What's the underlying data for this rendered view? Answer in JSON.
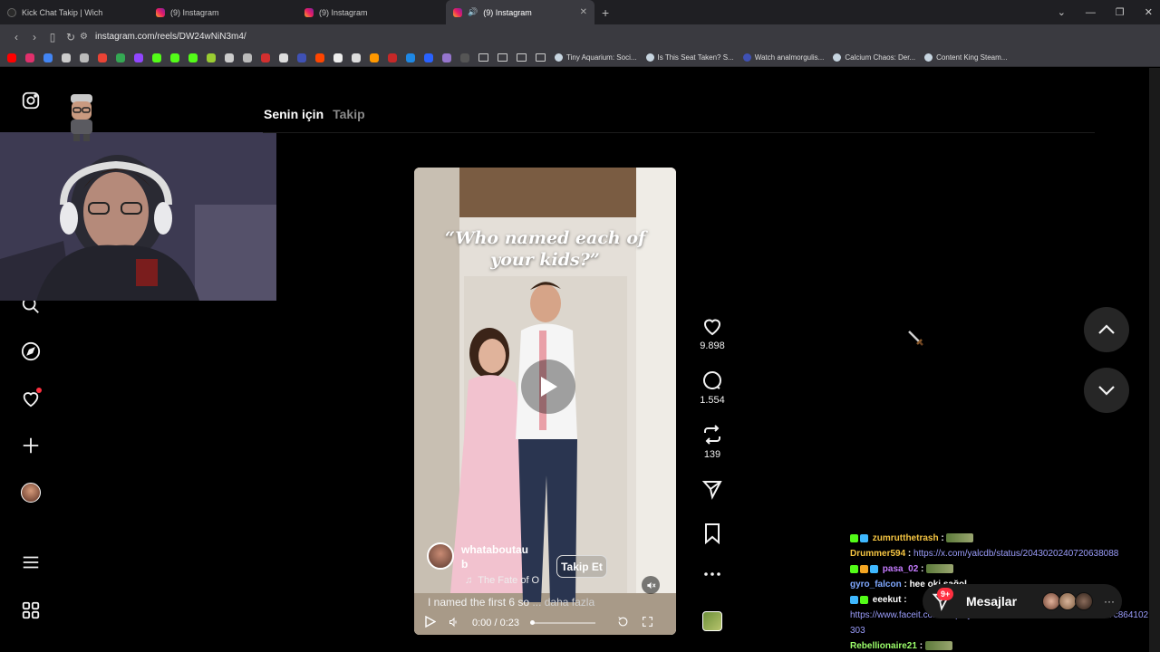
{
  "browser": {
    "tabs": [
      {
        "title": "Kick Chat Takip | Wich",
        "icon": "kick-icon",
        "active": false
      },
      {
        "title": "(9) Instagram",
        "icon": "instagram-icon",
        "active": false
      },
      {
        "title": "(9) Instagram",
        "icon": "instagram-icon",
        "active": false
      },
      {
        "title": "(9) Instagram",
        "icon": "instagram-icon",
        "active": true,
        "audio": true
      }
    ],
    "url": "instagram.com/reels/DW24wNiN3m4/",
    "bookmarks": [
      {
        "label": "Tiny Aquarium: Soci..."
      },
      {
        "label": "Is This Seat Taken? S..."
      },
      {
        "label": "Watch analmorgulis..."
      },
      {
        "label": "Calcium Chaos: Der..."
      },
      {
        "label": "Content King Steam..."
      }
    ]
  },
  "feed": {
    "tab_for_you": "Senin için",
    "tab_following": "Takip"
  },
  "reel": {
    "overlay_text": "“Who named each of your kids?”",
    "author": "whataboutaub",
    "music": "The Fate of O",
    "follow_label": "Takip Et",
    "caption": "I named the first 6 so",
    "more_label": "... daha fazla",
    "time": "0:00 / 0:23",
    "progress_fraction": 0.0
  },
  "actions": {
    "likes": "9.898",
    "comments": "1.554",
    "reposts": "139"
  },
  "chat": {
    "rows": [
      {
        "user": "zumrutthetrash",
        "color": "#f5c542",
        "text": "",
        "emote": true
      },
      {
        "user": "Drummer594",
        "color": "#f5c542",
        "text": "https://x.com/yalcdb/status/2043020240720638088",
        "link": true
      },
      {
        "user": "pasa_02",
        "color": "#c57bff",
        "text": "",
        "emote": true
      },
      {
        "user": "gyro_falcon",
        "color": "#7fa8ff",
        "text": "hee oki sağol"
      },
      {
        "user": "eeekut",
        "color": "#ffffff",
        "text": ""
      },
      {
        "user": "",
        "color": "#9b9dfb",
        "text": "https://www.faceit.com/en/players/Eolose/videos/69db6f4cd8b207c864102",
        "link": true
      },
      {
        "user": "",
        "color": "#9b9dfb",
        "text": "303",
        "link": true
      },
      {
        "user": "Rebellionaire21",
        "color": "#9cff6b",
        "text": "",
        "emote": true
      }
    ]
  },
  "messages": {
    "label": "Mesajlar",
    "badge": "9+"
  }
}
